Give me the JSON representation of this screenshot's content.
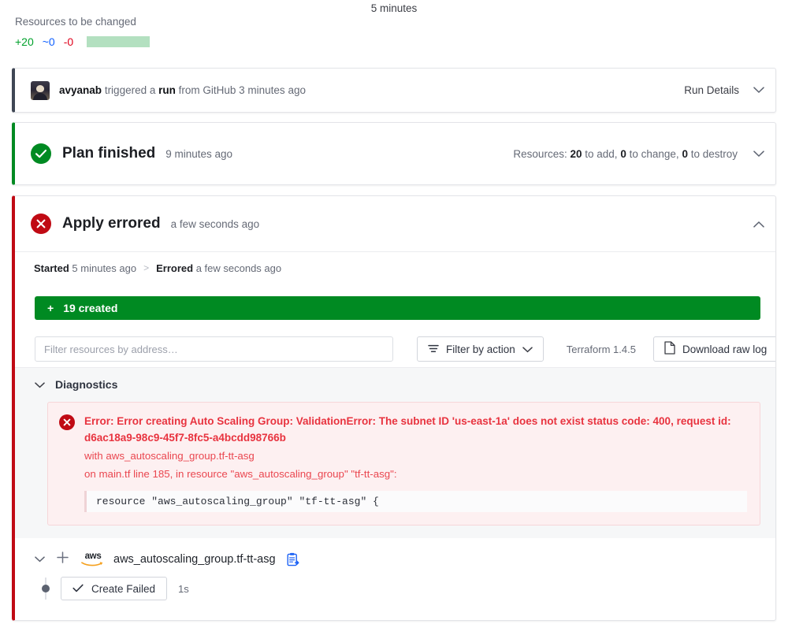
{
  "header": {
    "duration": "5 minutes",
    "resources_label": "Resources to be changed",
    "add": "+20",
    "change": "~0",
    "destroy": "-0"
  },
  "run_card": {
    "user": "avyanab",
    "action_pre": "triggered a",
    "action_bold": "run",
    "action_post": "from GitHub 3 minutes ago",
    "details_label": "Run Details",
    "chevron": "chevron-down"
  },
  "plan_card": {
    "title": "Plan finished",
    "time": "9 minutes ago",
    "meta_prefix": "Resources:",
    "add_count": "20",
    "add_label": "to add,",
    "change_count": "0",
    "change_label": "to change,",
    "destroy_count": "0",
    "destroy_label": "to destroy"
  },
  "apply_card": {
    "title": "Apply errored",
    "time": "a few seconds ago",
    "crumb_started_bold": "Started",
    "crumb_started_rest": "5 minutes ago",
    "crumb_sep": ">",
    "crumb_errored_bold": "Errored",
    "crumb_errored_rest": "a few seconds ago",
    "created_icon": "+",
    "created_label": "19 created",
    "toolbar": {
      "filter_placeholder": "Filter resources by address…",
      "filter_by_action": "Filter by action",
      "terraform_version": "Terraform 1.4.5",
      "download_raw_log": "Download raw log"
    },
    "diagnostics": {
      "section_label": "Diagnostics",
      "error_title": "Error: Error creating Auto Scaling Group: ValidationError: The subnet ID 'us-east-1a' does not exist status code: 400, request id: d6ac18a9-98c9-45f7-8fc5-a4bcdd98766b",
      "error_with": "with aws_autoscaling_group.tf-tt-asg",
      "error_on": "on main.tf line 185, in resource \"aws_autoscaling_group\" \"tf-tt-asg\":",
      "code_snippet": "resource \"aws_autoscaling_group\" \"tf-tt-asg\" {"
    },
    "resource": {
      "provider": "aws",
      "name": "aws_autoscaling_group.tf-tt-asg",
      "status_label": "Create Failed",
      "status_time": "1s"
    }
  },
  "colors": {
    "success": "#008a22",
    "error": "#c00a14",
    "accent_navy": "#3f4654",
    "add": "#00a12b",
    "change": "#1060ff",
    "destroy": "#e0001b",
    "bar_fill": "#b3e0c0",
    "link_blue": "#1c62f5"
  }
}
